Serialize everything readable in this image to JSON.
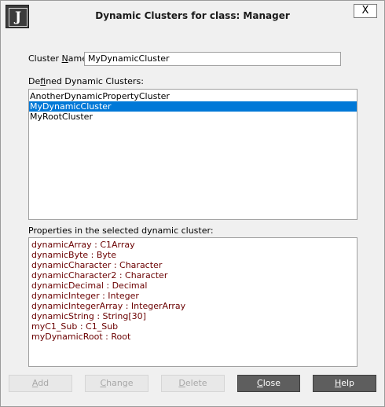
{
  "window": {
    "title": "Dynamic Clusters for class: Manager",
    "icon_letter": "J",
    "close_glyph": "X"
  },
  "cluster_name": {
    "label_prefix": "Cluster ",
    "label_mnemonic": "N",
    "label_suffix": "ame:",
    "value": "MyDynamicCluster"
  },
  "defined_clusters": {
    "label_prefix": "De",
    "label_mnemonic": "f",
    "label_suffix": "ined Dynamic Clusters:",
    "items": [
      "AnotherDynamicPropertyCluster",
      "MyDynamicCluster",
      "MyRootCluster"
    ],
    "selected_index": 1
  },
  "properties": {
    "label": "Properties in the selected dynamic cluster:",
    "items": [
      "dynamicArray : C1Array",
      "dynamicByte : Byte",
      "dynamicCharacter : Character",
      "dynamicCharacter2 : Character",
      "dynamicDecimal : Decimal",
      "dynamicInteger : Integer",
      "dynamicIntegerArray : IntegerArray",
      "dynamicString : String[30]",
      "myC1_Sub : C1_Sub",
      "myDynamicRoot : Root"
    ]
  },
  "buttons": {
    "add": {
      "mnemonic": "A",
      "rest": "dd"
    },
    "change": {
      "mnemonic": "C",
      "rest": "hange"
    },
    "delete": {
      "mnemonic": "D",
      "rest": "elete"
    },
    "close": {
      "mnemonic": "C",
      "rest": "lose"
    },
    "help": {
      "mnemonic": "H",
      "rest": "elp"
    }
  },
  "colors": {
    "selection": "#0078d7",
    "property_text": "#6a0000",
    "primary_button": "#5e5e5e"
  }
}
